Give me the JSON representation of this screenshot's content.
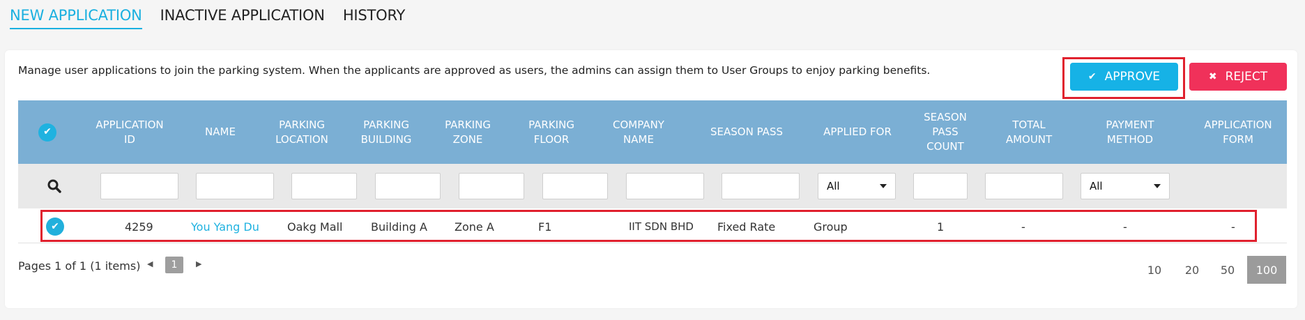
{
  "tabs": [
    {
      "label": "NEW APPLICATION"
    },
    {
      "label": "INACTIVE APPLICATION"
    },
    {
      "label": "HISTORY"
    }
  ],
  "description": "Manage user applications to join the parking system. When the applicants are approved as users, the admins can assign them to User Groups to enjoy parking benefits.",
  "actions": {
    "approve_label": "APPROVE",
    "reject_label": "REJECT"
  },
  "columns": [
    "APPLICATION ID",
    "NAME",
    "PARKING LOCATION",
    "PARKING BUILDING",
    "PARKING ZONE",
    "PARKING FLOOR",
    "COMPANY NAME",
    "SEASON PASS",
    "APPLIED FOR",
    "SEASON PASS COUNT",
    "TOTAL AMOUNT",
    "PAYMENT METHOD",
    "APPLICATION FORM"
  ],
  "filters": {
    "applied_for": "All",
    "payment_method": "All"
  },
  "rows": [
    {
      "application_id": "4259",
      "name": "You Yang Du",
      "parking_location": "Oakg Mall",
      "parking_building": "Building A",
      "parking_zone": "Zone A",
      "parking_floor": "F1",
      "company_name": "IIT SDN BHD",
      "season_pass": "Fixed Rate",
      "applied_for": "Group",
      "season_pass_count": "1",
      "total_amount": "-",
      "payment_method": "-",
      "application_form": "-"
    }
  ],
  "pager": {
    "summary": "Pages 1 of 1 (1 items)",
    "current_page": "1",
    "page_sizes": [
      "10",
      "20",
      "50",
      "100"
    ],
    "active_page_size": "100"
  },
  "colors": {
    "accent": "#1ab0e0",
    "header": "#7bafd4",
    "reject": "#f0315a",
    "highlight": "#e0212e"
  }
}
